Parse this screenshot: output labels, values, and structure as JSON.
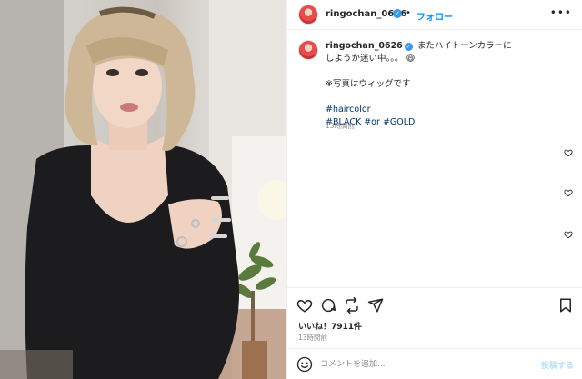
{
  "post": {
    "username": "ringochan_0626",
    "follow_label": "フォロー",
    "separator": "•",
    "more_label": "•••",
    "verified_icon": "verified-badge-icon",
    "caption": {
      "line1": "またハイトーンカラーに",
      "line2": "しようか迷い中。。。",
      "emoji": "😄",
      "note": "※写真はウィッグです",
      "hashtags_line1": "#haircolor",
      "hashtags_line2": [
        "#BLACK",
        "#or",
        "#GOLD"
      ],
      "time": "13時間前"
    },
    "likes": "いいね！7911件",
    "time": "13時間前",
    "comment": {
      "placeholder": "コメントを追加...",
      "value": "",
      "post_label": "投稿する"
    }
  },
  "icons": {
    "like": "heart-icon",
    "comment": "comment-icon",
    "share": "share-icon",
    "send": "send-icon",
    "save": "bookmark-icon",
    "emoji": "emoji-icon"
  },
  "colors": {
    "link": "#0095f6",
    "hashtag": "#00376b",
    "verified": "#3897f0",
    "muted": "#8e8e8e"
  }
}
